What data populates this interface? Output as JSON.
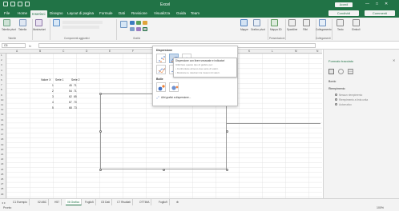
{
  "window": {
    "title": "Excel",
    "user_label": "Accedi",
    "min": "—",
    "max": "□",
    "close": "✕"
  },
  "tabs": [
    "File",
    "Home",
    "Inserisci",
    "Disegno",
    "Layout di pagina",
    "Formule",
    "Dati",
    "Revisione",
    "Visualizza",
    "Guida",
    "Team"
  ],
  "active_tab": "Inserisci",
  "share_label": "Condividi",
  "comments_label": "Commenti",
  "ribbon": {
    "pivot": "Tabella pivot",
    "table": "Tabella",
    "illustrations": "Illustrazioni",
    "addins": "Componenti aggiuntivi",
    "charts_group": "Grafici",
    "maps": "Mappe",
    "pivot_chart": "Grafico pivot",
    "tours": "Mappa 3D",
    "sparklines": "Sparkline",
    "filters": "Filtri",
    "link": "Collegamento",
    "text": "Testo",
    "symbols": "Simboli",
    "group_tables": "Tabelle",
    "group_tours": "Presentazioni",
    "group_links": "Collegamenti"
  },
  "formula": {
    "namebox": "C5",
    "fx": "fx"
  },
  "columns": [
    "A",
    "B",
    "C",
    "D",
    "E",
    "F",
    "G",
    "H",
    "I",
    "J",
    "K",
    "L",
    "M",
    "N"
  ],
  "rows": [
    "1",
    "2",
    "3",
    "4",
    "5",
    "6",
    "7",
    "8",
    "9",
    "10",
    "11",
    "12",
    "13",
    "14",
    "15",
    "16",
    "17",
    "18",
    "19",
    "20",
    "21",
    "22",
    "23",
    "24",
    "25",
    "26",
    "27",
    "28",
    "29"
  ],
  "table": {
    "headers": [
      "Valore X",
      "Serie 1",
      "Serie 2"
    ],
    "rows": [
      [
        "1",
        "45",
        "71"
      ],
      [
        "2",
        "54",
        "71"
      ],
      [
        "3",
        "62",
        "65"
      ],
      [
        "4",
        "67",
        "70"
      ],
      [
        "5",
        "68",
        "73"
      ]
    ]
  },
  "dropdown": {
    "heading_scatter": "Dispersione",
    "heading_bubble": "Bolle",
    "more": "Altri grafici a dispersione...",
    "tooltip_title": "Dispersione con linee smussate e indicatori",
    "tooltip_lines": [
      "Utilizzare questo tipo di grafico per:",
      "• Confrontare almeno due serie di valori.",
      "• Mostrare le relazioni tra insiemi di valori."
    ]
  },
  "pane": {
    "title": "Formato tracciato",
    "section_border": "Bordo",
    "section_fill": "Riempimento",
    "section_line": "Linea",
    "options": [
      "Nessun riempimento",
      "Riempimento a tinta unita",
      "Automatico"
    ]
  },
  "sheets": [
    "C1 Esempio",
    "02 ABC",
    "H57",
    "06 Grafico",
    "Foglio5",
    "C5 Dati",
    "C7 Risultati",
    "OTTIMA",
    "Foglio9"
  ],
  "active_sheet": "06 Grafico",
  "status": {
    "ready": "Pronto",
    "zoom": "100%"
  },
  "colors": {
    "accent": "#217346",
    "selected": "#c8d9ec"
  }
}
